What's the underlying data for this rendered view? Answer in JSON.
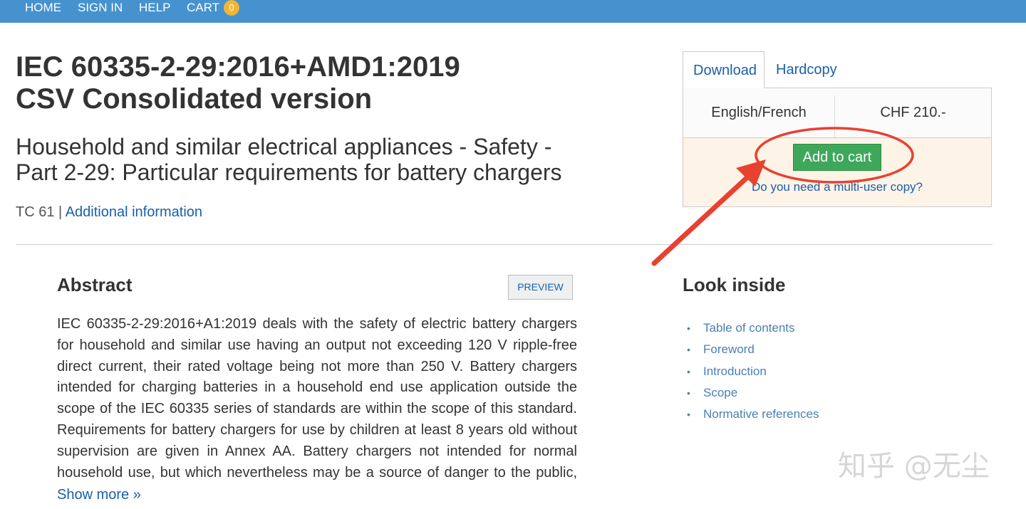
{
  "nav": {
    "home": "HOME",
    "sign_in": "SIGN IN",
    "help": "HELP",
    "cart": "CART",
    "cart_count": "0"
  },
  "product": {
    "title": "IEC 60335-2-29:2016+AMD1:2019 CSV Consolidated version",
    "subtitle": "Household and similar electrical appliances - Safety - Part 2-29: Particular requirements for battery chargers",
    "tc": "TC 61",
    "separator": "|",
    "additional_info": "Additional information"
  },
  "purchase": {
    "tabs": [
      "Download",
      "Hardcopy"
    ],
    "active_tab": "Download",
    "language": "English/French",
    "price": "CHF 210.-",
    "add_to_cart": "Add to cart",
    "multi_user": "Do you need a multi-user copy?"
  },
  "abstract": {
    "heading": "Abstract",
    "preview_label": "PREVIEW",
    "text": "IEC 60335-2-29:2016+A1:2019 deals with the safety of electric battery chargers for household and similar use having an output not exceeding 120 V ripple-free direct current, their rated voltage being not more than 250 V. Battery chargers intended for charging batteries in a household end use application outside the scope of the IEC 60335 series of standards are within the scope of this standard. Requirements for battery chargers for use by children at least 8 years old without supervision are given in Annex AA. Battery chargers not intended for normal household use, but which nevertheless may be a source of danger to the public, such as battery chargers",
    "show_more": "Show more »"
  },
  "look_inside": {
    "heading": "Look inside",
    "items": [
      "Table of contents",
      "Foreword",
      "Introduction",
      "Scope",
      "Normative references"
    ]
  },
  "watermark": "知乎 @无尘",
  "colors": {
    "nav_bg": "#4592cf",
    "badge": "#f2b632",
    "link": "#1a5fa8",
    "add_button": "#3ea85a",
    "buy_bg": "#fdf3e7",
    "annotation": "#e8412f"
  }
}
